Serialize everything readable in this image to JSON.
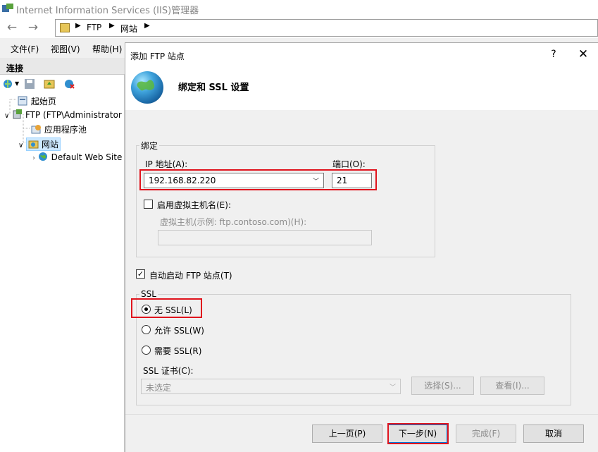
{
  "window": {
    "title": "Internet Information Services (IIS)管理器"
  },
  "address": {
    "crumbs": [
      "FTP",
      "网站"
    ]
  },
  "menu": [
    "文件(F)",
    "视图(V)",
    "帮助(H)"
  ],
  "connections": {
    "header": "连接",
    "tree": [
      {
        "label": "起始页",
        "icon": "start-page-icon"
      },
      {
        "label": "FTP (FTP\\Administrator",
        "icon": "server-icon"
      },
      {
        "label": "应用程序池",
        "icon": "app-pool-icon"
      },
      {
        "label": "网站",
        "icon": "sites-folder-icon"
      },
      {
        "label": "Default Web Site",
        "icon": "globe-icon"
      }
    ]
  },
  "dialog": {
    "title": "添加 FTP 站点",
    "help": "?",
    "close": "✕",
    "heading": "绑定和 SSL 设置",
    "binding": {
      "legend": "绑定",
      "ip_label": "IP 地址(A):",
      "ip_value": "192.168.82.220",
      "port_label": "端口(O):",
      "port_value": "21",
      "vhost_check_label": "启用虚拟主机名(E):",
      "vhost_checked": false,
      "vhost_label": "虚拟主机(示例: ftp.contoso.com)(H):",
      "vhost_value": ""
    },
    "autostart_label": "自动启动 FTP 站点(T)",
    "autostart_checked": true,
    "ssl": {
      "legend": "SSL",
      "options": [
        "无 SSL(L)",
        "允许 SSL(W)",
        "需要 SSL(R)"
      ],
      "selected_index": 0,
      "cert_label": "SSL 证书(C):",
      "cert_value": "未选定",
      "select_button": "选择(S)...",
      "view_button": "查看(I)..."
    },
    "buttons": {
      "prev": "上一页(P)",
      "next": "下一步(N)",
      "finish": "完成(F)",
      "cancel": "取消"
    }
  },
  "colors": {
    "highlight_box": "#e0141d"
  }
}
